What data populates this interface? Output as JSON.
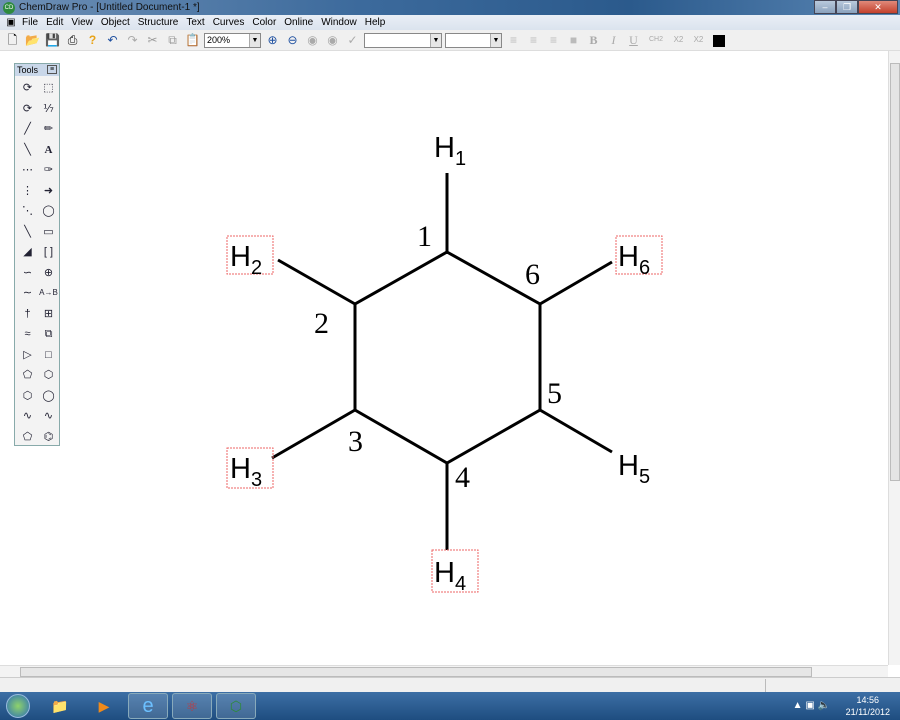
{
  "window": {
    "title": "ChemDraw Pro - [Untitled Document-1 *]",
    "app_icon": "CD"
  },
  "menu": [
    "File",
    "Edit",
    "View",
    "Object",
    "Structure",
    "Text",
    "Curves",
    "Color",
    "Online",
    "Window",
    "Help"
  ],
  "toolbar": {
    "zoom": "200%",
    "font_box": "",
    "size_box": "",
    "bold": "B",
    "italic": "I",
    "underline": "U",
    "formula": "CH2",
    "subscript": "X2",
    "superscript": "X2",
    "color": "#000000"
  },
  "palette": {
    "title": "Tools"
  },
  "molecule": {
    "carbon_numbers": [
      "1",
      "2",
      "3",
      "4",
      "5",
      "6"
    ],
    "hydrogens": [
      {
        "label": "H",
        "index": "1"
      },
      {
        "label": "H",
        "index": "2"
      },
      {
        "label": "H",
        "index": "3"
      },
      {
        "label": "H",
        "index": "4"
      },
      {
        "label": "H",
        "index": "5"
      },
      {
        "label": "H",
        "index": "6"
      }
    ]
  },
  "taskbar": {
    "time": "14:56",
    "date": "21/11/2012"
  }
}
